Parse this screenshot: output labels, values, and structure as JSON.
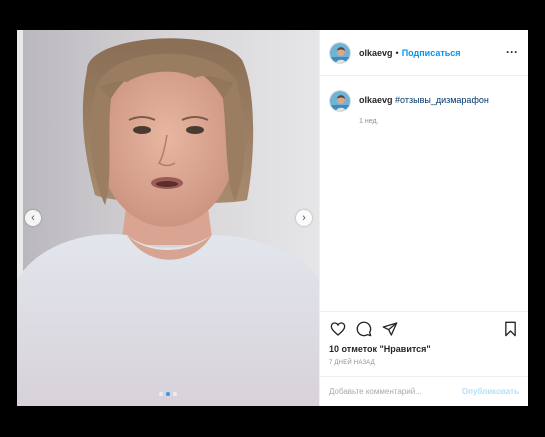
{
  "post": {
    "username": "olkaevg",
    "separator": "•",
    "follow_label": "Подписаться",
    "more_label": "···",
    "caption": {
      "username": "olkaevg",
      "hashtag": "#отзывы_дизмарафон",
      "time_ago": "1 нед."
    },
    "likes_text": "10 отметок \"Нравится\"",
    "posted_ago": "7 дней назад",
    "comment": {
      "placeholder": "Добавьте комментарий...",
      "value": "",
      "publish_label": "Опубликовать"
    },
    "carousel": {
      "slide_count": 3,
      "active_slide": 2
    }
  },
  "colors": {
    "background": "#000000",
    "link": "#0095f6",
    "publish_disabled": "#b2dffc",
    "text": "#262626",
    "muted": "#8e8e8e"
  },
  "icons": {
    "prev": "chevron-left-icon",
    "next": "chevron-right-icon",
    "like": "heart-icon",
    "comment": "comment-icon",
    "share": "paper-plane-icon",
    "save": "bookmark-icon"
  }
}
